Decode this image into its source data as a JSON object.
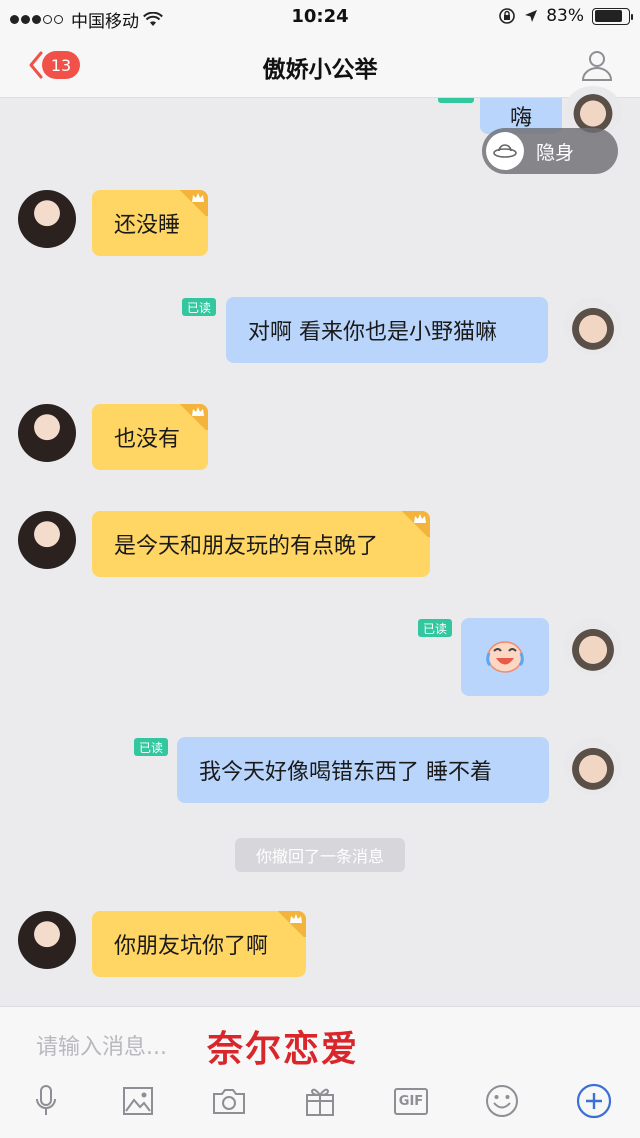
{
  "status_bar": {
    "carrier": "中国移动",
    "time": "10:24",
    "battery": "83%",
    "battery_level": 0.83
  },
  "nav": {
    "badge_count": "13",
    "title": "傲娇小公举"
  },
  "stealth_label": "隐身",
  "partial_message": "嗨",
  "messages": [
    {
      "side": "in",
      "text": "还没睡"
    },
    {
      "side": "out",
      "text": "对啊 看来你也是小野猫嘛",
      "read": "已读"
    },
    {
      "side": "in",
      "text": "也没有"
    },
    {
      "side": "in",
      "text": "是今天和朋友玩的有点晚了"
    },
    {
      "side": "out",
      "emoji": "laughing-crying-emoji",
      "read": "已读"
    },
    {
      "side": "out",
      "text": "我今天好像喝错东西了 睡不着",
      "read": "已读"
    },
    {
      "side": "in",
      "text": "你朋友坑你了啊"
    }
  ],
  "recall_notice": "你撤回了一条消息",
  "input": {
    "placeholder": "请输入消息...",
    "watermark": "奈尔恋爱"
  },
  "toolbar": {
    "items": [
      "microphone-icon",
      "image-icon",
      "camera-icon",
      "gift-icon",
      "gif-icon",
      "emoji-icon",
      "plus-icon"
    ],
    "gif_label": "GIF"
  },
  "colors": {
    "incoming_bubble": "#ffd663",
    "outgoing_bubble": "#b9d5fb",
    "read_tag": "#32c79f",
    "badge": "#f0524a",
    "accent": "#3a6fd8"
  }
}
